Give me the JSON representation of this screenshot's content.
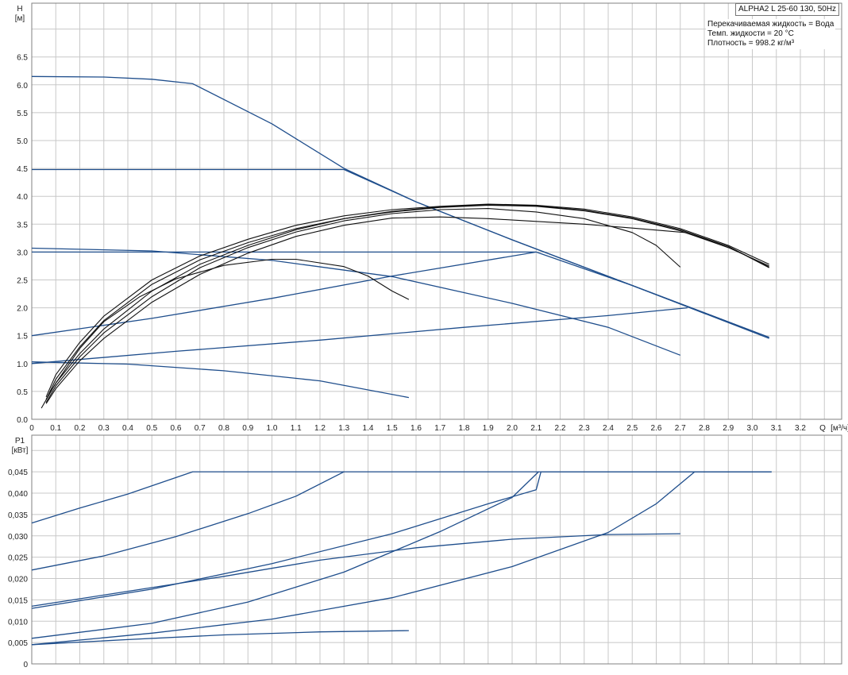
{
  "header": {
    "title": "ALPHA2 L 25-60 130, 50Hz",
    "info_lines": [
      "Перекачиваемая жидкость = Вода",
      "Темп. жидкости = 20 °C",
      "Плотность = 998.2 кг/м³"
    ]
  },
  "colors": {
    "blue": "#1f4e8c",
    "black": "#111111",
    "grid": "#c8c8c8",
    "frame": "#808080"
  },
  "chart_data": [
    {
      "id": "head",
      "type": "line",
      "ylabel": "H",
      "yunit": "[м]",
      "xlabel": "Q",
      "xunit": "[м³/ч]",
      "xlim": [
        0,
        3.4
      ],
      "ylim": [
        0,
        7.5
      ],
      "grid": true,
      "xticks": [
        0,
        0.1,
        0.2,
        0.3,
        0.4,
        0.5,
        0.6,
        0.7,
        0.8,
        0.9,
        1.0,
        1.1,
        1.2,
        1.3,
        1.4,
        1.5,
        1.6,
        1.7,
        1.8,
        1.9,
        2.0,
        2.1,
        2.2,
        2.3,
        2.4,
        2.5,
        2.6,
        2.7,
        2.8,
        2.9,
        3.0,
        3.1,
        3.2
      ],
      "xtick_labels": [
        "0",
        "0.1",
        "0.2",
        "0.3",
        "0.4",
        "0.5",
        "0.6",
        "0.7",
        "0.8",
        "0.9",
        "1.0",
        "1.1",
        "1.2",
        "1.3",
        "1.4",
        "1.5",
        "1.6",
        "1.7",
        "1.8",
        "1.9",
        "2.0",
        "2.1",
        "2.2",
        "2.3",
        "2.4",
        "2.5",
        "2.6",
        "2.7",
        "2.8",
        "2.9",
        "3.0",
        "3.1",
        "3.2"
      ],
      "yticks": [
        0,
        0.5,
        1.0,
        1.5,
        2.0,
        2.5,
        3.0,
        3.5,
        4.0,
        4.5,
        5.0,
        5.5,
        6.0,
        6.5
      ],
      "ytick_labels": [
        "0.0",
        "0.5",
        "1.0",
        "1.5",
        "2.0",
        "2.5",
        "3.0",
        "3.5",
        "4.0",
        "4.5",
        "5.0",
        "5.5",
        "6.0",
        "6.5"
      ],
      "series": [
        {
          "color": "blue",
          "points": [
            [
              0,
              6.15
            ],
            [
              0.3,
              6.14
            ],
            [
              0.5,
              6.1
            ],
            [
              0.67,
              6.02
            ],
            [
              1.0,
              5.3
            ],
            [
              1.3,
              4.5
            ],
            [
              1.6,
              3.9
            ],
            [
              2.0,
              3.22
            ],
            [
              2.5,
              2.4
            ],
            [
              3.07,
              1.45
            ]
          ]
        },
        {
          "color": "blue",
          "points": [
            [
              0,
              4.48
            ],
            [
              1.3,
              4.48
            ],
            [
              1.6,
              3.9
            ],
            [
              2.0,
              3.22
            ],
            [
              2.5,
              2.4
            ],
            [
              3.07,
              1.47
            ]
          ]
        },
        {
          "color": "blue",
          "points": [
            [
              0,
              3.0
            ],
            [
              2.1,
              3.0
            ],
            [
              2.5,
              2.4
            ],
            [
              3.07,
              1.47
            ]
          ]
        },
        {
          "color": "blue",
          "points": [
            [
              0,
              1.5
            ],
            [
              0.5,
              1.81
            ],
            [
              1.0,
              2.17
            ],
            [
              1.5,
              2.57
            ],
            [
              2.1,
              3.0
            ]
          ]
        },
        {
          "color": "blue",
          "points": [
            [
              0,
              1.0
            ],
            [
              0.6,
              1.22
            ],
            [
              1.2,
              1.42
            ],
            [
              1.8,
              1.65
            ],
            [
              2.4,
              1.86
            ],
            [
              2.73,
              2.0
            ]
          ]
        },
        {
          "color": "blue",
          "points": [
            [
              0,
              3.07
            ],
            [
              0.5,
              3.02
            ],
            [
              1.0,
              2.85
            ],
            [
              1.5,
              2.56
            ],
            [
              2.0,
              2.08
            ],
            [
              2.4,
              1.65
            ],
            [
              2.7,
              1.15
            ]
          ]
        },
        {
          "color": "blue",
          "points": [
            [
              0,
              1.03
            ],
            [
              0.4,
              0.99
            ],
            [
              0.8,
              0.87
            ],
            [
              1.2,
              0.69
            ],
            [
              1.57,
              0.39
            ]
          ]
        },
        {
          "color": "black",
          "points": [
            [
              0.04,
              0.2
            ],
            [
              0.1,
              0.65
            ],
            [
              0.2,
              1.27
            ],
            [
              0.3,
              1.75
            ],
            [
              0.45,
              2.2
            ],
            [
              0.6,
              2.52
            ],
            [
              0.8,
              2.76
            ],
            [
              1.0,
              2.87
            ],
            [
              1.1,
              2.87
            ],
            [
              1.3,
              2.74
            ],
            [
              1.4,
              2.57
            ],
            [
              1.5,
              2.3
            ],
            [
              1.57,
              2.15
            ]
          ]
        },
        {
          "color": "black",
          "points": [
            [
              0.06,
              0.28
            ],
            [
              0.1,
              0.55
            ],
            [
              0.2,
              1.05
            ],
            [
              0.3,
              1.45
            ],
            [
              0.5,
              2.1
            ],
            [
              0.7,
              2.6
            ],
            [
              0.9,
              2.98
            ],
            [
              1.1,
              3.28
            ],
            [
              1.3,
              3.48
            ],
            [
              1.5,
              3.61
            ],
            [
              1.7,
              3.63
            ],
            [
              1.9,
              3.6
            ],
            [
              2.1,
              3.55
            ],
            [
              2.3,
              3.5
            ],
            [
              2.5,
              3.43
            ],
            [
              2.72,
              3.35
            ],
            [
              2.9,
              3.1
            ],
            [
              3.07,
              2.72
            ]
          ]
        },
        {
          "color": "black",
          "points": [
            [
              0.06,
              0.3
            ],
            [
              0.1,
              0.6
            ],
            [
              0.2,
              1.12
            ],
            [
              0.3,
              1.55
            ],
            [
              0.5,
              2.2
            ],
            [
              0.7,
              2.72
            ],
            [
              0.9,
              3.08
            ],
            [
              1.1,
              3.36
            ],
            [
              1.3,
              3.56
            ],
            [
              1.5,
              3.69
            ],
            [
              1.7,
              3.76
            ],
            [
              1.9,
              3.78
            ],
            [
              2.1,
              3.72
            ],
            [
              2.3,
              3.6
            ],
            [
              2.5,
              3.35
            ],
            [
              2.6,
              3.12
            ],
            [
              2.7,
              2.73
            ]
          ]
        },
        {
          "color": "black",
          "points": [
            [
              0.06,
              0.35
            ],
            [
              0.1,
              0.72
            ],
            [
              0.2,
              1.3
            ],
            [
              0.3,
              1.77
            ],
            [
              0.5,
              2.42
            ],
            [
              0.7,
              2.86
            ],
            [
              0.9,
              3.17
            ],
            [
              1.1,
              3.42
            ],
            [
              1.3,
              3.6
            ],
            [
              1.5,
              3.72
            ],
            [
              1.7,
              3.8
            ],
            [
              1.9,
              3.84
            ],
            [
              2.1,
              3.82
            ],
            [
              2.3,
              3.74
            ],
            [
              2.5,
              3.6
            ],
            [
              2.7,
              3.38
            ],
            [
              2.9,
              3.08
            ],
            [
              3.07,
              2.75
            ]
          ]
        },
        {
          "color": "black",
          "points": [
            [
              0.06,
              0.4
            ],
            [
              0.1,
              0.8
            ],
            [
              0.2,
              1.38
            ],
            [
              0.3,
              1.85
            ],
            [
              0.5,
              2.5
            ],
            [
              0.7,
              2.93
            ],
            [
              0.9,
              3.23
            ],
            [
              1.1,
              3.48
            ],
            [
              1.3,
              3.65
            ],
            [
              1.5,
              3.76
            ],
            [
              1.7,
              3.82
            ],
            [
              1.9,
              3.86
            ],
            [
              2.1,
              3.84
            ],
            [
              2.3,
              3.77
            ],
            [
              2.5,
              3.63
            ],
            [
              2.7,
              3.42
            ],
            [
              2.9,
              3.12
            ],
            [
              3.07,
              2.78
            ]
          ]
        },
        {
          "color": "black",
          "points": [
            [
              0.06,
              0.36
            ],
            [
              0.1,
              0.65
            ],
            [
              0.2,
              1.18
            ],
            [
              0.3,
              1.62
            ],
            [
              0.5,
              2.3
            ],
            [
              0.7,
              2.78
            ],
            [
              0.9,
              3.12
            ],
            [
              1.1,
              3.4
            ],
            [
              1.3,
              3.6
            ],
            [
              1.5,
              3.73
            ],
            [
              1.7,
              3.81
            ],
            [
              1.9,
              3.85
            ],
            [
              2.1,
              3.83
            ],
            [
              2.3,
              3.75
            ],
            [
              2.5,
              3.61
            ],
            [
              2.7,
              3.4
            ],
            [
              2.9,
              3.1
            ],
            [
              3.07,
              2.73
            ]
          ]
        }
      ]
    },
    {
      "id": "power",
      "type": "line",
      "ylabel": "P1",
      "yunit": "[кВт]",
      "xlim": [
        0,
        3.4
      ],
      "ylim": [
        0,
        0.05
      ],
      "grid": true,
      "xticks": [
        0,
        0.1,
        0.2,
        0.3,
        0.4,
        0.5,
        0.6,
        0.7,
        0.8,
        0.9,
        1.0,
        1.1,
        1.2,
        1.3,
        1.4,
        1.5,
        1.6,
        1.7,
        1.8,
        1.9,
        2.0,
        2.1,
        2.2,
        2.3,
        2.4,
        2.5,
        2.6,
        2.7,
        2.8,
        2.9,
        3.0,
        3.1,
        3.2,
        3.3
      ],
      "yticks": [
        0,
        0.005,
        0.01,
        0.015,
        0.02,
        0.025,
        0.03,
        0.035,
        0.04,
        0.045
      ],
      "ytick_labels": [
        "0",
        "0,005",
        "0,010",
        "0,015",
        "0,020",
        "0,025",
        "0,030",
        "0,035",
        "0,040",
        "0,045"
      ],
      "series": [
        {
          "color": "blue",
          "points": [
            [
              0,
              0.033
            ],
            [
              0.2,
              0.0365
            ],
            [
              0.4,
              0.0398
            ],
            [
              0.67,
              0.045
            ],
            [
              3.08,
              0.045
            ]
          ]
        },
        {
          "color": "blue",
          "points": [
            [
              0,
              0.022
            ],
            [
              0.3,
              0.0253
            ],
            [
              0.6,
              0.0298
            ],
            [
              0.9,
              0.0352
            ],
            [
              1.1,
              0.0393
            ],
            [
              1.3,
              0.045
            ]
          ]
        },
        {
          "color": "blue",
          "points": [
            [
              0,
              0.013
            ],
            [
              0.5,
              0.0175
            ],
            [
              1.0,
              0.0235
            ],
            [
              1.5,
              0.0305
            ],
            [
              1.9,
              0.0375
            ],
            [
              2.1,
              0.0408
            ],
            [
              2.12,
              0.045
            ],
            [
              3.08,
              0.045
            ]
          ]
        },
        {
          "color": "blue",
          "points": [
            [
              0,
              0.006
            ],
            [
              0.5,
              0.0095
            ],
            [
              0.9,
              0.0145
            ],
            [
              1.3,
              0.0215
            ],
            [
              1.7,
              0.031
            ],
            [
              2.0,
              0.039
            ],
            [
              2.11,
              0.045
            ]
          ]
        },
        {
          "color": "blue",
          "points": [
            [
              0,
              0.0045
            ],
            [
              0.5,
              0.0072
            ],
            [
              1.0,
              0.0105
            ],
            [
              1.5,
              0.0155
            ],
            [
              2.0,
              0.0228
            ],
            [
              2.4,
              0.0308
            ],
            [
              2.6,
              0.0375
            ],
            [
              2.76,
              0.045
            ],
            [
              3.08,
              0.045
            ]
          ]
        },
        {
          "color": "blue",
          "points": [
            [
              0,
              0.0135
            ],
            [
              0.4,
              0.017
            ],
            [
              0.8,
              0.0205
            ],
            [
              1.2,
              0.0243
            ],
            [
              1.6,
              0.0272
            ],
            [
              2.0,
              0.0292
            ],
            [
              2.4,
              0.0303
            ],
            [
              2.7,
              0.0305
            ]
          ]
        },
        {
          "color": "blue",
          "points": [
            [
              0,
              0.0045
            ],
            [
              0.4,
              0.0057
            ],
            [
              0.8,
              0.0068
            ],
            [
              1.2,
              0.0075
            ],
            [
              1.57,
              0.0078
            ]
          ]
        }
      ]
    }
  ]
}
